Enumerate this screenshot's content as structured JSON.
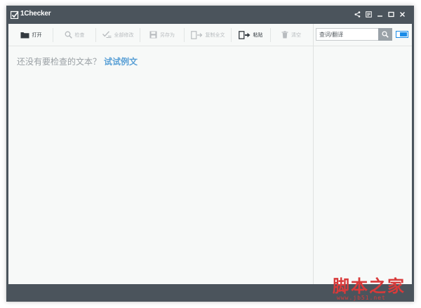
{
  "window": {
    "title": "1Checker"
  },
  "titlebar_controls": [
    {
      "name": "share-icon"
    },
    {
      "name": "notes-icon"
    },
    {
      "name": "minimize-icon"
    },
    {
      "name": "maximize-icon"
    },
    {
      "name": "close-icon"
    }
  ],
  "toolbar": {
    "open_label": "打开",
    "check_label": "检查",
    "fix_all_label": "全部修改",
    "save_as_label": "另存为",
    "copy_all_label": "复制全文",
    "paste_label": "粘贴",
    "clear_label": "清空"
  },
  "editor": {
    "hint_text": "还没有要检查的文本？",
    "sample_link": "试试例文"
  },
  "side": {
    "search_placeholder": "查词/翻译"
  },
  "watermark": {
    "main": "脚本之家",
    "sub": "www.jb51.net"
  },
  "colors": {
    "titlebar": "#4b545c",
    "panel": "#f7f9f8",
    "accent_link": "#5aa0d6",
    "toggle_blue": "#1a8ce8",
    "watermark_red": "#d83a3a"
  }
}
